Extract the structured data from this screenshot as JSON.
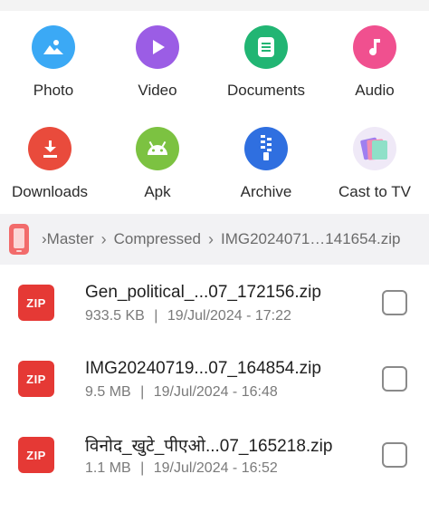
{
  "categories": [
    {
      "label": "Photo",
      "icon": "image-icon",
      "color": "#3ba9f5"
    },
    {
      "label": "Video",
      "icon": "play-icon",
      "color": "#9b5de5"
    },
    {
      "label": "Documents",
      "icon": "document-icon",
      "color": "#21b573"
    },
    {
      "label": "Audio",
      "icon": "music-note-icon",
      "color": "#f0508f"
    },
    {
      "label": "Downloads",
      "icon": "download-icon",
      "color": "#e94b3c"
    },
    {
      "label": "Apk",
      "icon": "android-icon",
      "color": "#7cc241"
    },
    {
      "label": "Archive",
      "icon": "zipper-icon",
      "color": "#2f6fe0"
    },
    {
      "label": "Cast to TV",
      "icon": "cast-cards-icon",
      "color": "#b58cf0"
    }
  ],
  "breadcrumb": {
    "icon": "phone-storage-icon",
    "items": [
      "›Master",
      "Compressed",
      "IMG2024071…141654.zip"
    ]
  },
  "files": [
    {
      "type_badge": "ZIP",
      "name": "Gen_political_...07_172156.zip",
      "size": "933.5 KB",
      "date": "19/Jul/2024 - 17:22"
    },
    {
      "type_badge": "ZIP",
      "name": "IMG20240719...07_164854.zip",
      "size": "9.5 MB",
      "date": "19/Jul/2024 - 16:48"
    },
    {
      "type_badge": "ZIP",
      "name": "विनोद_खुटे_पीएओ...07_165218.zip",
      "size": "1.1 MB",
      "date": "19/Jul/2024 - 16:52"
    }
  ],
  "meta_separator": "|"
}
